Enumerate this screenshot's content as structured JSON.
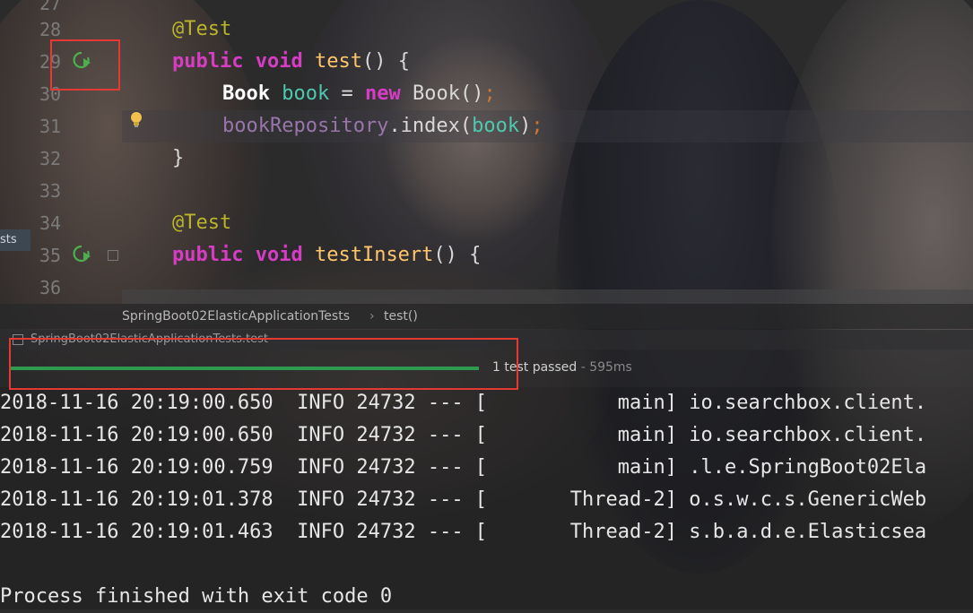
{
  "editor": {
    "line_numbers": [
      "27",
      "28",
      "29",
      "30",
      "31",
      "32",
      "33",
      "34",
      "35",
      "36"
    ],
    "code": {
      "annotation_1": "@Test",
      "method1_public": "public",
      "method1_void": "void",
      "method1_name": "test",
      "method1_rest": "() {",
      "line30_class": "Book",
      "line30_var": "book",
      "line30_eq": " = ",
      "line30_new": "new",
      "line30_ctor": " Book()",
      "line30_semi": ";",
      "line31_field": "bookRepository",
      "line31_call": ".index(",
      "line31_arg": "book",
      "line31_close": ")",
      "line31_semi": ";",
      "line32_brace": "}",
      "annotation_2": "@Test",
      "method2_public": "public",
      "method2_void": "void",
      "method2_name": "testInsert",
      "method2_rest": "() {"
    },
    "side_tab_label": "sts"
  },
  "breadcrumb": {
    "class_name": "SpringBoot02ElasticApplicationTests",
    "separator": "›",
    "method": "test()"
  },
  "run_panel": {
    "title": "SpringBoot02ElasticApplicationTests.test",
    "progress": 1.0,
    "status_text": "1 test passed",
    "duration": " - 595ms",
    "progress_color": "#2d9a4f"
  },
  "console": {
    "lines": [
      "2018-11-16 20:19:00.650  INFO 24732 --- [           main] io.searchbox.client.",
      "2018-11-16 20:19:00.650  INFO 24732 --- [           main] io.searchbox.client.",
      "2018-11-16 20:19:00.759  INFO 24732 --- [           main] .l.e.SpringBoot02Ela",
      "2018-11-16 20:19:01.378  INFO 24732 --- [       Thread-2] o.s.w.c.s.GenericWeb",
      "2018-11-16 20:19:01.463  INFO 24732 --- [       Thread-2] s.b.a.d.e.Elasticsea",
      "",
      "Process finished with exit code 0"
    ]
  },
  "colors": {
    "highlight": "#e53935",
    "keyword": "#d63cc4",
    "annotation": "#bbb529",
    "method": "#ffc66d",
    "variable": "#4ec9b0",
    "field": "#9876aa"
  },
  "icons": [
    "run-test-icon",
    "lightbulb-icon",
    "fold-icon"
  ]
}
